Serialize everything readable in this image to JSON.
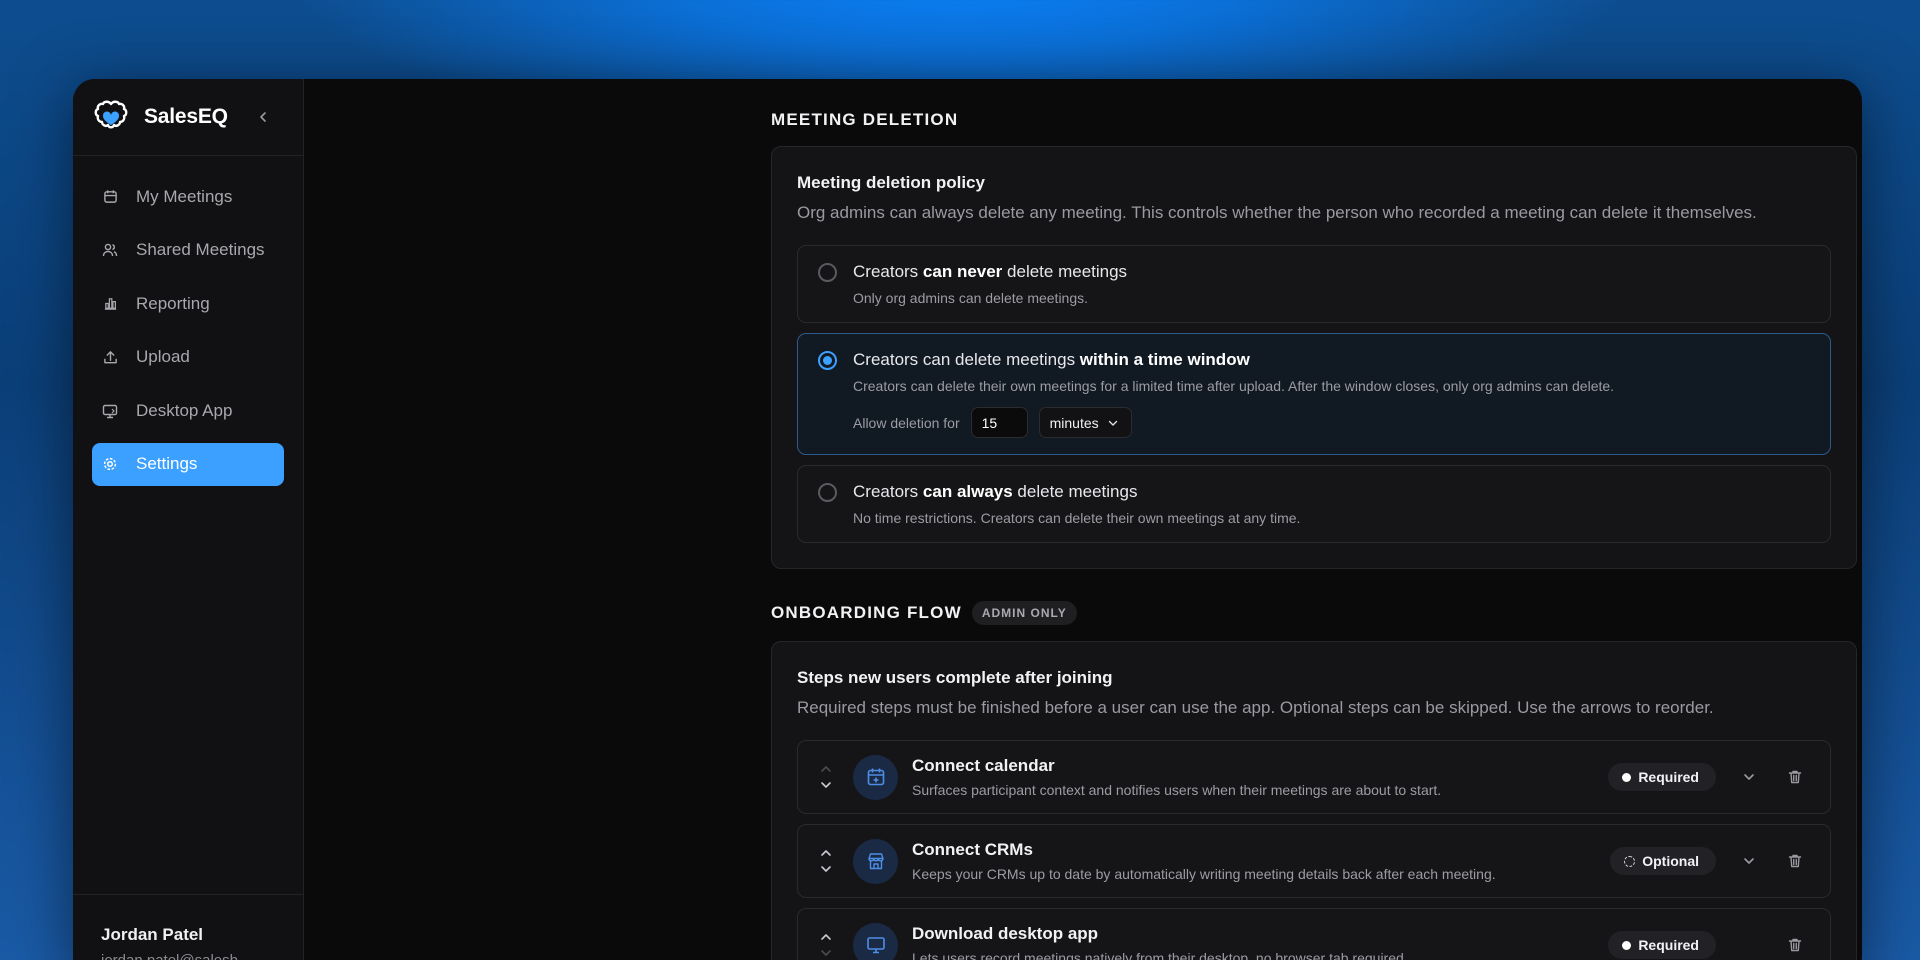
{
  "app": {
    "name": "SalesEQ",
    "brand_color": "#3ba0ff"
  },
  "sidebar": {
    "items": [
      {
        "label": "My Meetings",
        "icon": "calendar-icon",
        "active": false
      },
      {
        "label": "Shared Meetings",
        "icon": "users-icon",
        "active": false
      },
      {
        "label": "Reporting",
        "icon": "bar-chart-icon",
        "active": false
      },
      {
        "label": "Upload",
        "icon": "upload-icon",
        "active": false
      },
      {
        "label": "Desktop App",
        "icon": "desktop-icon",
        "active": false
      },
      {
        "label": "Settings",
        "icon": "gear-icon",
        "active": true
      }
    ],
    "user": {
      "name": "Jordan Patel",
      "email": "jordan.patel@salesb…"
    }
  },
  "meeting_deletion": {
    "section_title": "MEETING DELETION",
    "card_title": "Meeting deletion policy",
    "card_desc": "Org admins can always delete any meeting. This controls whether the person who recorded a meeting can delete it themselves.",
    "options": [
      {
        "title_pre": "Creators ",
        "title_bold": "can never",
        "title_post": " delete meetings",
        "desc": "Only org admins can delete meetings.",
        "selected": false
      },
      {
        "title_pre": "Creators can delete meetings ",
        "title_bold": "within a time window",
        "title_post": "",
        "desc": "Creators can delete their own meetings for a limited time after upload. After the window closes, only org admins can delete.",
        "selected": true,
        "allow_label": "Allow deletion for",
        "amount": "15",
        "unit": "minutes"
      },
      {
        "title_pre": "Creators ",
        "title_bold": "can always",
        "title_post": " delete meetings",
        "desc": "No time restrictions. Creators can delete their own meetings at any time.",
        "selected": false
      }
    ]
  },
  "onboarding": {
    "section_title": "ONBOARDING FLOW",
    "badge": "ADMIN ONLY",
    "card_title": "Steps new users complete after joining",
    "card_desc": "Required steps must be finished before a user can use the app. Optional steps can be skipped. Use the arrows to reorder.",
    "steps": [
      {
        "title": "Connect calendar",
        "desc": "Surfaces participant context and notifies users when their meetings are about to start.",
        "status": "Required",
        "icon": "calendar-plus-icon"
      },
      {
        "title": "Connect CRMs",
        "desc": "Keeps your CRMs up to date by automatically writing meeting details back after each meeting.",
        "status": "Optional",
        "icon": "store-icon"
      },
      {
        "title": "Download desktop app",
        "desc": "Lets users record meetings natively from their desktop, no browser tab required.",
        "status": "Required",
        "icon": "monitor-icon"
      }
    ]
  }
}
